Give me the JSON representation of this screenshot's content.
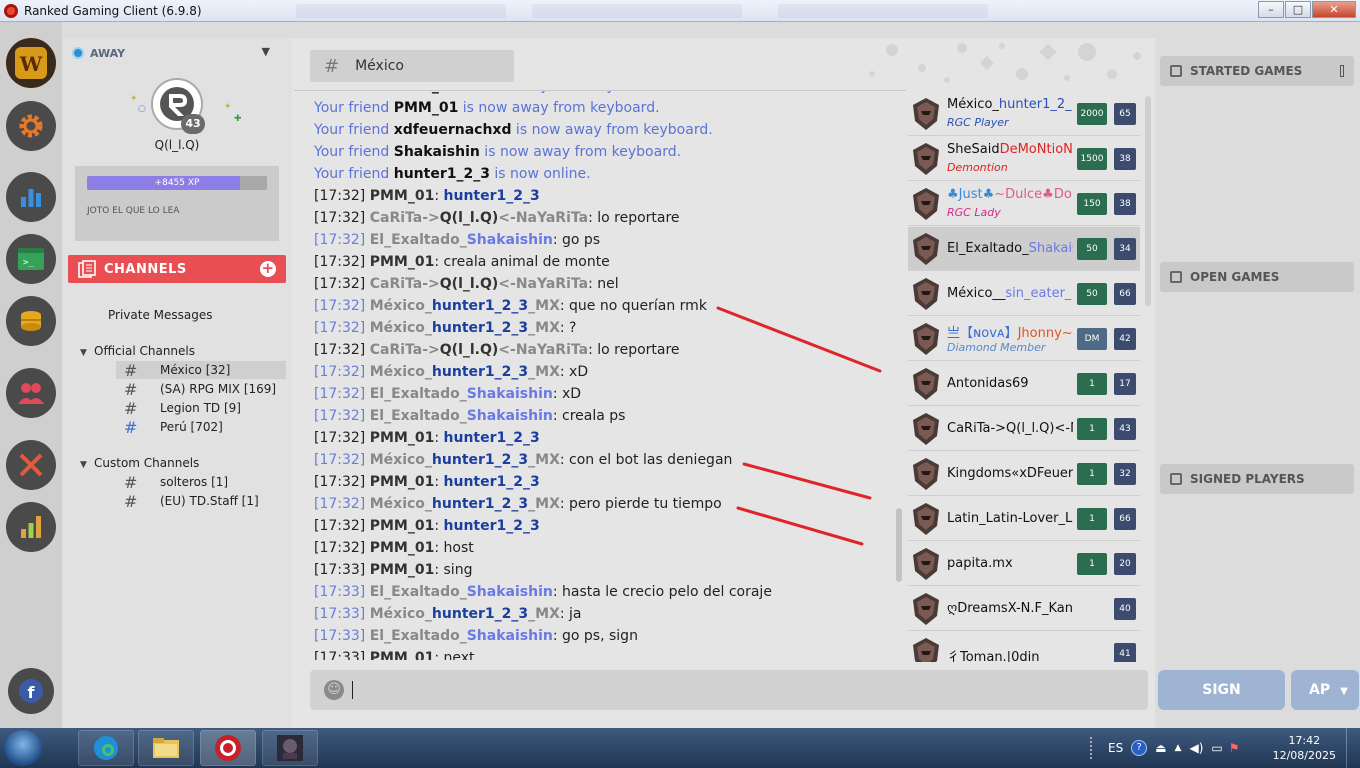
{
  "window": {
    "title": "Ranked Gaming Client (6.9.8)",
    "minimize": "–",
    "maximize": "□",
    "close": "✕"
  },
  "iconbar": [
    {
      "name": "warcraft-icon",
      "color": "#d89a1a"
    },
    {
      "name": "settings-icon",
      "color": "#e8782a"
    },
    {
      "name": "stats-icon",
      "color": "#3a8ee0"
    },
    {
      "name": "console-icon",
      "color": "#35a25a"
    },
    {
      "name": "coins-icon",
      "color": "#e5a81e"
    },
    {
      "name": "friends-icon",
      "color": "#e0495a"
    },
    {
      "name": "swords-icon",
      "color": "#e25a3a"
    },
    {
      "name": "ranking-icon",
      "color": "#e0a23a"
    },
    {
      "name": "facebook-icon",
      "color": "#3b5ba6"
    }
  ],
  "user": {
    "status": "AWAY",
    "name": "Q(l_l.Q)",
    "level": "43",
    "xp_label": "+8455 XP",
    "xp_fraction": 0.85,
    "motto": "JOTO EL QUE LO LEA"
  },
  "channels": {
    "header": "CHANNELS",
    "add": "+",
    "private_messages": "Private Messages",
    "official_title": "Official Channels",
    "official": [
      {
        "label": "México [32]"
      },
      {
        "label": "(SA) RPG MIX [169]"
      },
      {
        "label": "Legion TD [9]"
      },
      {
        "label": "Perú [702]"
      }
    ],
    "custom_title": "Custom Channels",
    "custom": [
      {
        "label": "solteros [1]"
      },
      {
        "label": "(EU) TD.Staff [1]"
      }
    ]
  },
  "chat": {
    "channel_name": "México",
    "hash": "#",
    "messages": [
      {
        "type": "sys",
        "pre": "Your friend ",
        "name": "PMM_01",
        "post": " is now away from keyboard."
      },
      {
        "type": "sys",
        "pre": "Your friend ",
        "name": "PMM_01",
        "post": " is now away from keyboard."
      },
      {
        "type": "sys",
        "pre": "Your friend ",
        "name": "xdfeuernachxd",
        "post": " is now away from keyboard."
      },
      {
        "type": "sys",
        "pre": "Your friend ",
        "name": "Shakaishin",
        "post": " is now away from keyboard."
      },
      {
        "type": "sys",
        "pre": "Your friend ",
        "name": "hunter1_2_3",
        "post": " is now online."
      },
      {
        "ts": "[17:32]",
        "tsBlue": false,
        "parts": [
          [
            "n",
            "PMM_01"
          ],
          [
            "t",
            ": "
          ],
          [
            "nb",
            "hunter1_2_3"
          ]
        ]
      },
      {
        "ts": "[17:32]",
        "tsBlue": false,
        "parts": [
          [
            "g",
            "CaRiTa->"
          ],
          [
            "n",
            "Q(l_l.Q)"
          ],
          [
            "g",
            "<-NaYaRiTa"
          ],
          [
            "t",
            ": lo reportare"
          ]
        ]
      },
      {
        "ts": "[17:32]",
        "tsBlue": true,
        "parts": [
          [
            "g",
            "El_Exaltado_"
          ],
          [
            "nl",
            "Shakaishin"
          ],
          [
            "t",
            ": go ps"
          ]
        ]
      },
      {
        "ts": "[17:32]",
        "tsBlue": false,
        "parts": [
          [
            "n",
            "PMM_01"
          ],
          [
            "t",
            ": creala animal de monte"
          ]
        ]
      },
      {
        "ts": "[17:32]",
        "tsBlue": false,
        "parts": [
          [
            "g",
            "CaRiTa->"
          ],
          [
            "n",
            "Q(l_l.Q)"
          ],
          [
            "g",
            "<-NaYaRiTa"
          ],
          [
            "t",
            ": nel"
          ]
        ]
      },
      {
        "ts": "[17:32]",
        "tsBlue": true,
        "parts": [
          [
            "g",
            "México_"
          ],
          [
            "nb",
            "hunter1_2_3"
          ],
          [
            "g",
            "_MX"
          ],
          [
            "t",
            ": que no querían rmk"
          ]
        ]
      },
      {
        "ts": "[17:32]",
        "tsBlue": true,
        "parts": [
          [
            "g",
            "México_"
          ],
          [
            "nb",
            "hunter1_2_3"
          ],
          [
            "g",
            "_MX"
          ],
          [
            "t",
            ": ?"
          ]
        ]
      },
      {
        "ts": "[17:32]",
        "tsBlue": false,
        "parts": [
          [
            "g",
            "CaRiTa->"
          ],
          [
            "n",
            "Q(l_l.Q)"
          ],
          [
            "g",
            "<-NaYaRiTa"
          ],
          [
            "t",
            ": lo reportare"
          ]
        ]
      },
      {
        "ts": "[17:32]",
        "tsBlue": true,
        "parts": [
          [
            "g",
            "México_"
          ],
          [
            "nb",
            "hunter1_2_3"
          ],
          [
            "g",
            "_MX"
          ],
          [
            "t",
            ": xD"
          ]
        ]
      },
      {
        "ts": "[17:32]",
        "tsBlue": true,
        "parts": [
          [
            "g",
            "El_Exaltado_"
          ],
          [
            "nl",
            "Shakaishin"
          ],
          [
            "t",
            ": xD"
          ]
        ]
      },
      {
        "ts": "[17:32]",
        "tsBlue": true,
        "parts": [
          [
            "g",
            "El_Exaltado_"
          ],
          [
            "nl",
            "Shakaishin"
          ],
          [
            "t",
            ": creala ps"
          ]
        ]
      },
      {
        "ts": "[17:32]",
        "tsBlue": false,
        "parts": [
          [
            "n",
            "PMM_01"
          ],
          [
            "t",
            ": "
          ],
          [
            "nb",
            "hunter1_2_3"
          ]
        ]
      },
      {
        "ts": "[17:32]",
        "tsBlue": true,
        "parts": [
          [
            "g",
            "México_"
          ],
          [
            "nb",
            "hunter1_2_3"
          ],
          [
            "g",
            "_MX"
          ],
          [
            "t",
            ": con el bot las deniegan"
          ]
        ]
      },
      {
        "ts": "[17:32]",
        "tsBlue": false,
        "parts": [
          [
            "n",
            "PMM_01"
          ],
          [
            "t",
            ": "
          ],
          [
            "nb",
            "hunter1_2_3"
          ]
        ]
      },
      {
        "ts": "[17:32]",
        "tsBlue": true,
        "parts": [
          [
            "g",
            "México_"
          ],
          [
            "nb",
            "hunter1_2_3"
          ],
          [
            "g",
            "_MX"
          ],
          [
            "t",
            ": pero pierde tu tiempo"
          ]
        ]
      },
      {
        "ts": "[17:32]",
        "tsBlue": false,
        "parts": [
          [
            "n",
            "PMM_01"
          ],
          [
            "t",
            ": "
          ],
          [
            "nb",
            "hunter1_2_3"
          ]
        ]
      },
      {
        "ts": "[17:32]",
        "tsBlue": false,
        "parts": [
          [
            "n",
            "PMM_01"
          ],
          [
            "t",
            ": host"
          ]
        ]
      },
      {
        "ts": "[17:33]",
        "tsBlue": false,
        "parts": [
          [
            "n",
            "PMM_01"
          ],
          [
            "t",
            ": sing"
          ]
        ]
      },
      {
        "ts": "[17:33]",
        "tsBlue": true,
        "parts": [
          [
            "g",
            "El_Exaltado_"
          ],
          [
            "nl",
            "Shakaishin"
          ],
          [
            "t",
            ": hasta le crecio pelo del coraje"
          ]
        ]
      },
      {
        "ts": "[17:33]",
        "tsBlue": true,
        "parts": [
          [
            "g",
            "México_"
          ],
          [
            "nb",
            "hunter1_2_3"
          ],
          [
            "g",
            "_MX"
          ],
          [
            "t",
            ": ja"
          ]
        ]
      },
      {
        "ts": "[17:33]",
        "tsBlue": true,
        "parts": [
          [
            "g",
            "El_Exaltado_"
          ],
          [
            "nl",
            "Shakaishin"
          ],
          [
            "t",
            ": go ps, sign"
          ]
        ]
      },
      {
        "ts": "[17:33]",
        "tsBlue": false,
        "parts": [
          [
            "n",
            "PMM_01"
          ],
          [
            "t",
            ": next"
          ]
        ]
      }
    ]
  },
  "players": [
    {
      "parts": [
        [
          "#111",
          "México_"
        ],
        [
          "#2a4fb8",
          "hunter1_2_"
        ]
      ],
      "sub": "RGC Player",
      "subColor": "#2a4fb8",
      "points": "2000",
      "level": "65"
    },
    {
      "parts": [
        [
          "#111",
          "SheSaid"
        ],
        [
          "#d22",
          "DeMoNtioN"
        ]
      ],
      "sub": "Demontion",
      "subColor": "#d22",
      "points": "1500",
      "level": "38"
    },
    {
      "parts": [
        [
          "#3c8ad6",
          "♣Just♣"
        ],
        [
          "#e05b8a",
          "~Dulce♣Do♣i"
        ]
      ],
      "sub": "RGC Lady",
      "subColor": "#d22a8a",
      "points": "150",
      "level": "38"
    },
    {
      "parts": [
        [
          "#111",
          "El_Exaltado_"
        ],
        [
          "#6b79e3",
          "Shakais"
        ]
      ],
      "sub": "",
      "subColor": "",
      "points": "50",
      "level": "34",
      "selected": true
    },
    {
      "parts": [
        [
          "#111",
          "México__"
        ],
        [
          "#6b79e3",
          "sin_eater_"
        ]
      ],
      "sub": "",
      "subColor": "",
      "points": "50",
      "level": "66"
    },
    {
      "parts": [
        [
          "#3a6fd8",
          "亗【ɴᴏᴠᴀ】"
        ],
        [
          "#e0561f",
          "Jhonny~Br"
        ]
      ],
      "sub": "Diamond Member",
      "subColor": "#5a88c8",
      "points": "DM",
      "level": "42",
      "dm": true
    },
    {
      "parts": [
        [
          "#111",
          "Antonidas69"
        ]
      ],
      "sub": "",
      "subColor": "",
      "points": "1",
      "level": "17"
    },
    {
      "parts": [
        [
          "#111",
          "CaRiTa->Q(l_l.Q)<-N"
        ]
      ],
      "sub": "",
      "subColor": "",
      "points": "1",
      "level": "43"
    },
    {
      "parts": [
        [
          "#111",
          "Kingdoms«xDFeuern"
        ]
      ],
      "sub": "",
      "subColor": "",
      "points": "1",
      "level": "32"
    },
    {
      "parts": [
        [
          "#111",
          "Latin_Latin-Lover_L"
        ]
      ],
      "sub": "",
      "subColor": "",
      "points": "1",
      "level": "66"
    },
    {
      "parts": [
        [
          "#111",
          "papita.mx"
        ]
      ],
      "sub": "",
      "subColor": "",
      "points": "1",
      "level": "20"
    },
    {
      "parts": [
        [
          "#111",
          "ღDreamsX-N.F_Kan"
        ]
      ],
      "sub": "",
      "subColor": "",
      "points": "",
      "level": "40"
    },
    {
      "parts": [
        [
          "#111",
          "彳Toman.|0din"
        ]
      ],
      "sub": "",
      "subColor": "",
      "points": "",
      "level": "41"
    }
  ],
  "right_panel": {
    "started": "STARTED GAMES",
    "open": "OPEN GAMES",
    "signed": "SIGNED PLAYERS",
    "sign": "SIGN",
    "ap": "AP"
  },
  "taskbar": {
    "lang": "ES",
    "time": "17:42",
    "date": "12/08/2025"
  }
}
